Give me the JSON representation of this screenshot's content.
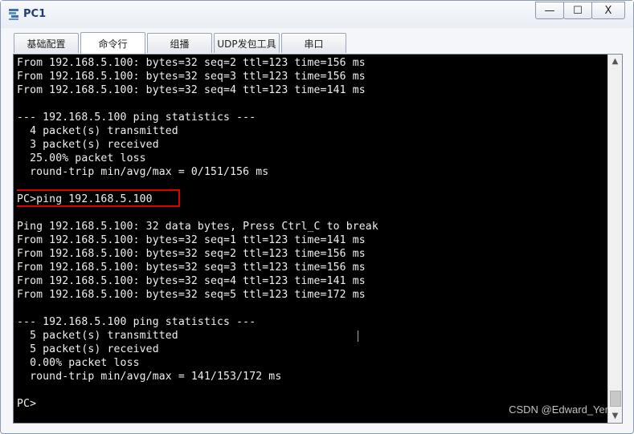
{
  "window": {
    "title": "PC1",
    "minimize": "—",
    "maximize": "☐",
    "close": "X"
  },
  "tabs": [
    {
      "label": "基础配置"
    },
    {
      "label": "命令行",
      "active": true
    },
    {
      "label": "组播"
    },
    {
      "label": "UDP发包工具"
    },
    {
      "label": "串口"
    }
  ],
  "terminal": {
    "lines": [
      "From 192.168.5.100: bytes=32 seq=2 ttl=123 time=156 ms",
      "From 192.168.5.100: bytes=32 seq=3 ttl=123 time=156 ms",
      "From 192.168.5.100: bytes=32 seq=4 ttl=123 time=141 ms",
      "",
      "--- 192.168.5.100 ping statistics ---",
      "  4 packet(s) transmitted",
      "  3 packet(s) received",
      "  25.00% packet loss",
      "  round-trip min/avg/max = 0/151/156 ms",
      "",
      "PC>ping 192.168.5.100",
      "",
      "Ping 192.168.5.100: 32 data bytes, Press Ctrl_C to break",
      "From 192.168.5.100: bytes=32 seq=1 ttl=123 time=141 ms",
      "From 192.168.5.100: bytes=32 seq=2 ttl=123 time=156 ms",
      "From 192.168.5.100: bytes=32 seq=3 ttl=123 time=156 ms",
      "From 192.168.5.100: bytes=32 seq=4 ttl=123 time=141 ms",
      "From 192.168.5.100: bytes=32 seq=5 ttl=123 time=172 ms",
      "",
      "--- 192.168.5.100 ping statistics ---",
      "  5 packet(s) transmitted",
      "  5 packet(s) received",
      "  0.00% packet loss",
      "  round-trip min/avg/max = 141/153/172 ms",
      "",
      "PC>"
    ]
  },
  "watermark": "CSDN @Edward_Yen",
  "colors": {
    "terminal_bg": "#000000",
    "terminal_fg": "#f0f0f0",
    "highlight": "#e00000"
  }
}
